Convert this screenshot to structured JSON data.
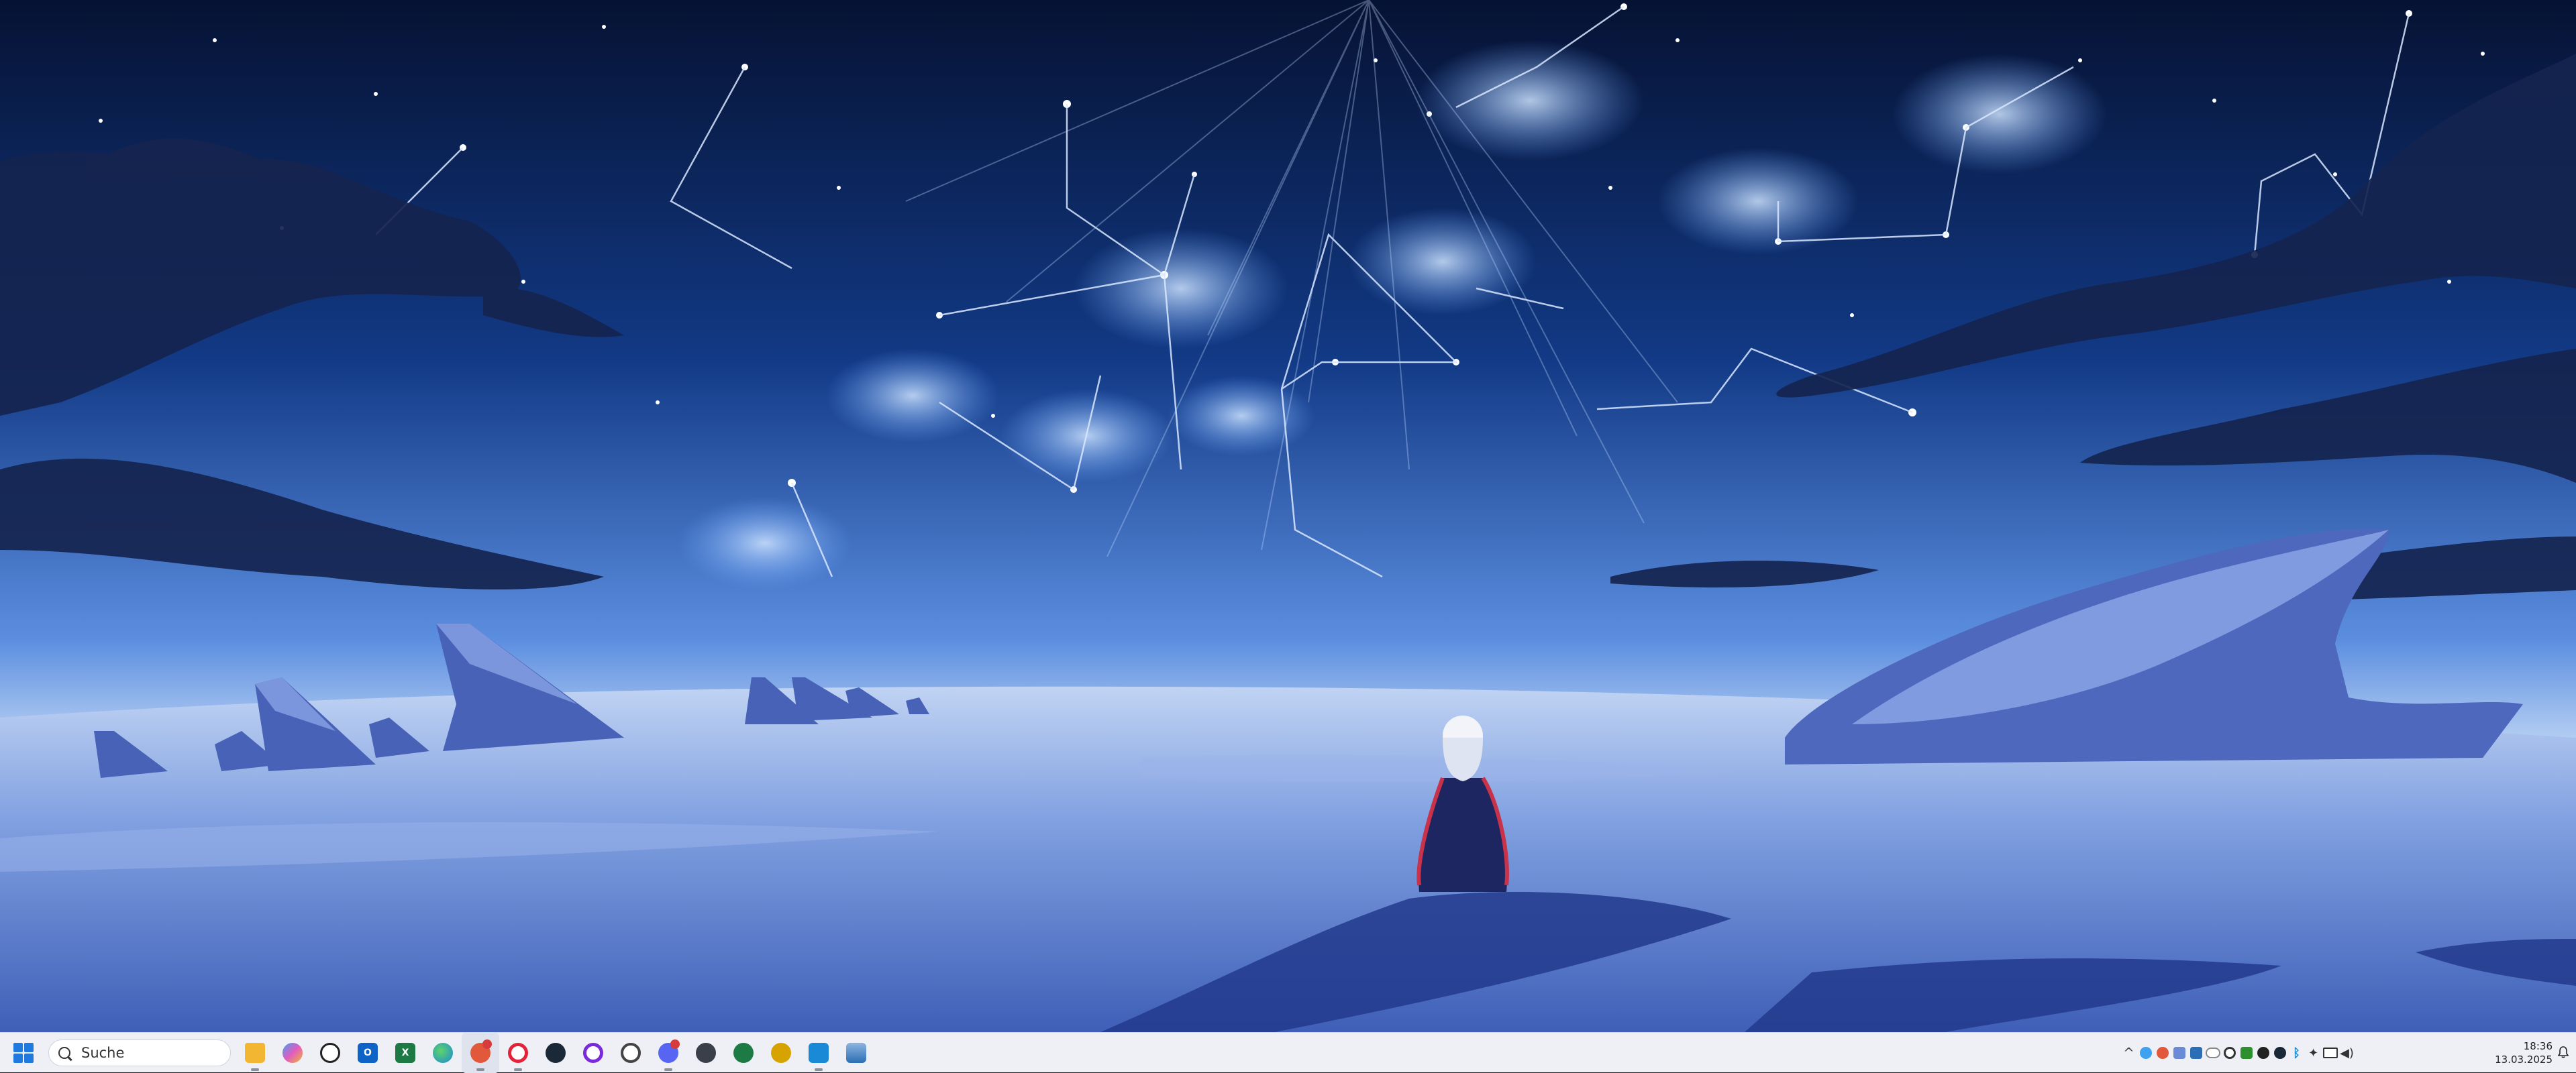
{
  "taskbar": {
    "search": {
      "label": "Suche"
    },
    "apps": [
      {
        "name": "file-explorer",
        "color": "#f2b632",
        "glyph": ""
      },
      {
        "name": "copilot",
        "color": "#3fa2f0",
        "glyph": ""
      },
      {
        "name": "chatgpt",
        "color": "#222222",
        "glyph": ""
      },
      {
        "name": "outlook",
        "color": "#0f63c7",
        "glyph": "O"
      },
      {
        "name": "excel",
        "color": "#1d7a44",
        "glyph": "X"
      },
      {
        "name": "edge",
        "color": "#1b8ad6",
        "glyph": ""
      },
      {
        "name": "tweak-app",
        "color": "#e2583a",
        "glyph": ""
      },
      {
        "name": "opera",
        "color": "#e2233a",
        "glyph": "O"
      },
      {
        "name": "steam",
        "color": "#1b2838",
        "glyph": ""
      },
      {
        "name": "ring-app",
        "color": "#7a2ad8",
        "glyph": ""
      },
      {
        "name": "target-app",
        "color": "#444444",
        "glyph": ""
      },
      {
        "name": "discord",
        "color": "#5865f2",
        "glyph": ""
      },
      {
        "name": "lock-app",
        "color": "#3b3f4a",
        "glyph": ""
      },
      {
        "name": "xbox-app",
        "color": "#1d7a44",
        "glyph": ""
      },
      {
        "name": "aimp-app",
        "color": "#d6a300",
        "glyph": ""
      },
      {
        "name": "blue-app",
        "color": "#1b8ad6",
        "glyph": ""
      },
      {
        "name": "game-app",
        "color": "#2a6fb5",
        "glyph": ""
      }
    ],
    "tray_icons": [
      {
        "name": "chevron-up",
        "color": "#444444"
      },
      {
        "name": "copilot-tray",
        "color": "#3fa2f0"
      },
      {
        "name": "app-tray",
        "color": "#e2583a"
      },
      {
        "name": "pen-tray",
        "color": "#6a8bd6"
      },
      {
        "name": "monitor-tray",
        "color": "#2a6fb5"
      },
      {
        "name": "cloud-tray",
        "color": "#888888"
      },
      {
        "name": "gpu-tray",
        "color": "#333333"
      },
      {
        "name": "nvidia-tray",
        "color": "#2d8f2d"
      },
      {
        "name": "circle-tray",
        "color": "#222222"
      },
      {
        "name": "steam-tray",
        "color": "#1b2838"
      },
      {
        "name": "bluetooth-tray",
        "color": "#1b8ad6"
      },
      {
        "name": "usb-tray",
        "color": "#333333"
      },
      {
        "name": "display-tray",
        "color": "#333333"
      },
      {
        "name": "speaker-tray",
        "color": "#333333"
      }
    ],
    "clock": {
      "time": "18:36",
      "date": "13.03.2025"
    }
  }
}
